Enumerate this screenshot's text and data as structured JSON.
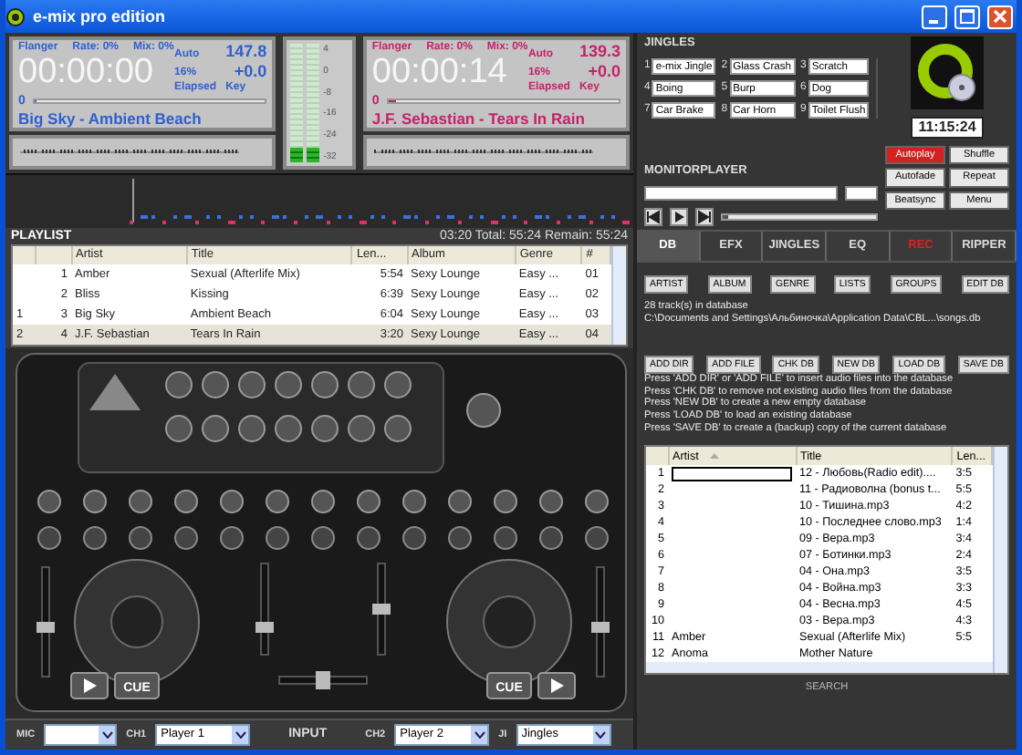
{
  "window": {
    "title": "e-mix pro edition"
  },
  "decks": [
    {
      "color": "#2f5fd0",
      "effect": "Flanger",
      "rate": "Rate: 0%",
      "mix": "Mix: 0%",
      "mode": "Auto",
      "bpm": "147.8",
      "range": "16%",
      "pitch": "+0.0",
      "time_mode": "Elapsed",
      "key": "Key",
      "time": "00:00:00",
      "marker": "0",
      "level": 0,
      "track": "Big Sky - Ambient Beach"
    },
    {
      "color": "#c8206a",
      "effect": "Flanger",
      "rate": "Rate: 0%",
      "mix": "Mix: 0%",
      "mode": "Auto",
      "bpm": "139.3",
      "range": "16%",
      "pitch": "+0.0",
      "time_mode": "Elapsed",
      "key": "Key",
      "time": "00:00:14",
      "marker": "0",
      "level": 0.03,
      "track": "J.F. Sebastian - Tears In Rain"
    }
  ],
  "vu_meter": {
    "scale": [
      "4",
      "0",
      "-8",
      "-16",
      "-24",
      "-32"
    ],
    "channels": [
      {
        "level": 0.12
      },
      {
        "level": 0.12
      }
    ]
  },
  "jingles": {
    "title": "JINGLES",
    "slots": [
      {
        "number": "1",
        "name": "e-mix Jingle"
      },
      {
        "number": "2",
        "name": "Glass Crash"
      },
      {
        "number": "3",
        "name": "Scratch"
      },
      {
        "number": "4",
        "name": "Boing"
      },
      {
        "number": "5",
        "name": "Burp"
      },
      {
        "number": "6",
        "name": "Dog"
      },
      {
        "number": "7",
        "name": "Car Brake"
      },
      {
        "number": "8",
        "name": "Car Horn"
      },
      {
        "number": "9",
        "name": "Toilet Flush"
      }
    ]
  },
  "clock": "11:15:24",
  "monitor_player": {
    "title": "MONITORPLAYER",
    "level": 0
  },
  "player_buttons": [
    {
      "label": "Autoplay",
      "on": true
    },
    {
      "label": "Shuffle",
      "on": false
    },
    {
      "label": "Autofade",
      "on": false
    },
    {
      "label": "Repeat",
      "on": false
    },
    {
      "label": "Beatsync",
      "on": false
    },
    {
      "label": "Menu",
      "on": false
    }
  ],
  "playlist": {
    "title": "PLAYLIST",
    "summary": "03:20 Total: 55:24 Remain: 55:24",
    "columns": [
      "Artist",
      "Title",
      "Len...",
      "Album",
      "Genre",
      "#"
    ],
    "rows": [
      {
        "number": "1",
        "artist": "Amber",
        "title": "Sexual (Afterlife Mix)",
        "length": "5:54",
        "album": "Sexy Lounge",
        "genre": "Easy ...",
        "track": "01",
        "selected": false
      },
      {
        "number": "2",
        "artist": "Bliss",
        "title": "Kissing",
        "length": "6:39",
        "album": "Sexy Lounge",
        "genre": "Easy ...",
        "track": "02",
        "selected": false
      },
      {
        "column_1": "1",
        "number": "3",
        "artist": "Big Sky",
        "title": "Ambient Beach",
        "length": "6:04",
        "album": "Sexy Lounge",
        "genre": "Easy ...",
        "track": "03",
        "selected": false
      },
      {
        "column_1": "2",
        "number": "4",
        "artist": "J.F. Sebastian",
        "title": "Tears In Rain",
        "length": "3:20",
        "album": "Sexy Lounge",
        "genre": "Easy ...",
        "track": "04",
        "selected": true
      }
    ]
  },
  "controller": {
    "cue_labels": [
      "CUE",
      "CUE"
    ]
  },
  "input_bar": [
    {
      "kind": "select",
      "label": "MIC"
    },
    {
      "kind": "select",
      "label": "CH1",
      "value": "Player 1"
    },
    {
      "kind": "title",
      "label": "INPUT"
    },
    {
      "kind": "select",
      "label": "CH2",
      "value": "Player 2"
    },
    {
      "kind": "select",
      "label": "JI",
      "value": "Jingles"
    }
  ],
  "tabs": [
    {
      "label": "DB",
      "selected": true,
      "kind": "normal"
    },
    {
      "label": "EFX",
      "selected": false,
      "kind": "normal"
    },
    {
      "label": "JINGLES",
      "selected": false,
      "kind": "normal"
    },
    {
      "label": "EQ",
      "selected": false,
      "kind": "normal"
    },
    {
      "label": "REC",
      "selected": false,
      "kind": "record"
    },
    {
      "label": "RIPPER",
      "selected": false,
      "kind": "normal"
    }
  ],
  "db_panel": {
    "view_buttons": [
      "ARTIST",
      "ALBUM",
      "GENRE",
      "LISTS",
      "GROUPS",
      "EDIT DB"
    ],
    "track_count": "28 track(s) in database",
    "path": "C:\\Documents and Settings\\Альбиночка\\Application Data\\CBL...\\songs.db",
    "action_buttons": [
      "ADD DIR",
      "ADD FILE",
      "CHK DB",
      "NEW DB",
      "LOAD DB",
      "SAVE DB"
    ],
    "help": [
      "Press 'ADD DIR' or 'ADD FILE' to insert audio files into the database",
      "Press 'CHK DB' to remove not existing audio files from the database",
      "Press 'NEW DB' to create a new empty database",
      "Press 'LOAD DB' to load an existing database",
      "Press 'SAVE DB' to create a (backup) copy of the current database"
    ],
    "table": {
      "columns": [
        "Artist",
        "Title",
        "Len..."
      ],
      "rows": [
        {
          "number": "1",
          "title": "12 - Любовь(Radio edit)....",
          "length": "3:5",
          "editing": true
        },
        {
          "number": "2",
          "title": "11 - Радиоволна (bonus t...",
          "length": "5:5",
          "editing": false
        },
        {
          "number": "3",
          "title": "10 - Тишина.mp3",
          "length": "4:2",
          "editing": false
        },
        {
          "number": "4",
          "title": "10 - Последнее слово.mp3",
          "length": "1:4",
          "editing": false
        },
        {
          "number": "5",
          "title": "09 - Вера.mp3",
          "length": "3:4",
          "editing": false
        },
        {
          "number": "6",
          "title": "07 - Ботинки.mp3",
          "length": "2:4",
          "editing": false
        },
        {
          "number": "7",
          "title": "04 - Она.mp3",
          "length": "3:5",
          "editing": false
        },
        {
          "number": "8",
          "title": "04 - Война.mp3",
          "length": "3:3",
          "editing": false
        },
        {
          "number": "9",
          "title": "04 - Весна.mp3",
          "length": "4:5",
          "editing": false
        },
        {
          "number": "10",
          "title": "03 - Вера.mp3",
          "length": "4:3",
          "editing": false
        },
        {
          "number": "11",
          "artist": "Amber",
          "title": "Sexual (Afterlife Mix)",
          "length": "5:5",
          "editing": false
        },
        {
          "number": "12",
          "artist": "Anoma",
          "title": "Mother Nature",
          "editing": false
        }
      ]
    },
    "search": "SEARCH"
  }
}
